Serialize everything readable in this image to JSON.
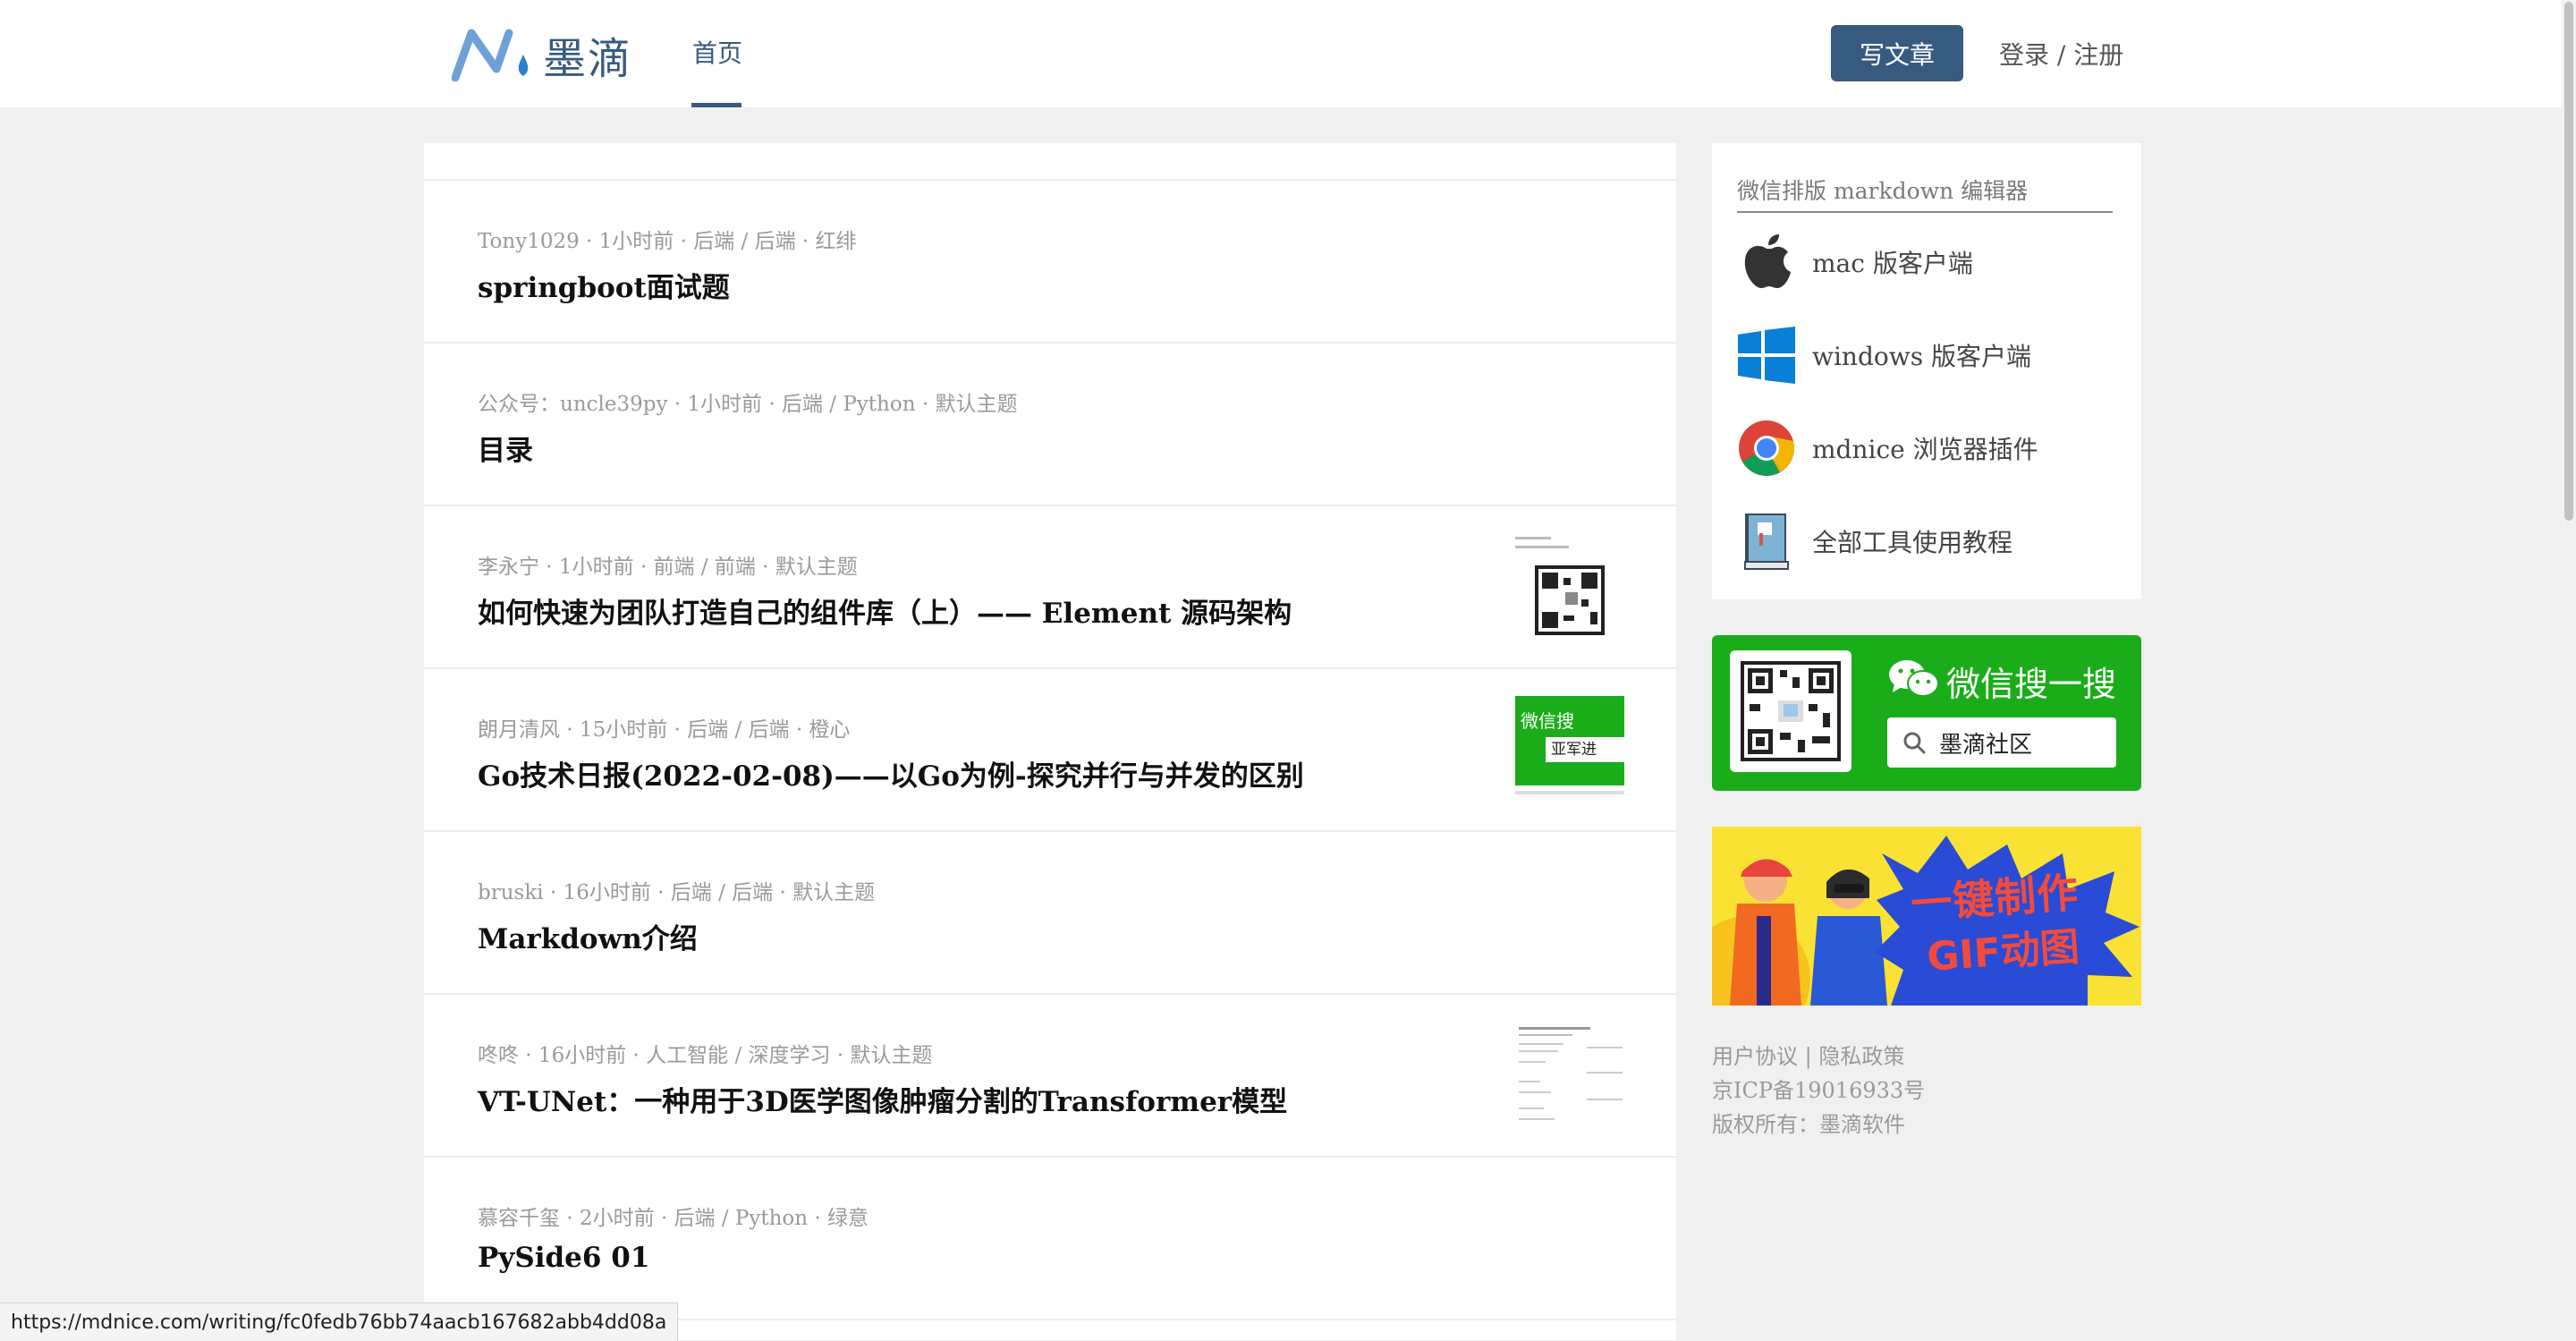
{
  "header": {
    "logo_text": "墨滴",
    "nav_home": "首页",
    "write_button": "写文章",
    "login": "登录",
    "separator": " / ",
    "register": "注册"
  },
  "articles": [
    {
      "meta": "Tony1029 · 1小时前 · 后端 / 后端 · 红绯",
      "title": "springboot面试题",
      "thumb": ""
    },
    {
      "meta": "公众号：uncle39py · 1小时前 · 后端 / Python · 默认主题",
      "title": "目录",
      "thumb": ""
    },
    {
      "meta": "李永宁 · 1小时前 · 前端 / 前端 · 默认主题",
      "title": "如何快速为团队打造自己的组件库（上）—— Element 源码架构",
      "thumb": "qr"
    },
    {
      "meta": "朗月清风 · 15小时前 · 后端 / 后端 · 橙心",
      "title": "Go技术日报(2022-02-08)——以Go为例-探究并行与并发的区别",
      "thumb": "wechat"
    },
    {
      "meta": "bruski · 16小时前 · 后端 / 后端 · 默认主题",
      "title": "Markdown介绍",
      "thumb": ""
    },
    {
      "meta": "咚咚 · 16小时前 · 人工智能 / 深度学习 · 默认主题",
      "title": "VT-UNet：一种用于3D医学图像肿瘤分割的Transformer模型",
      "thumb": "paper"
    },
    {
      "meta": "慕容千玺 · 2小时前 · 后端 / Python · 绿意",
      "title": "PySide6 01",
      "thumb": ""
    }
  ],
  "thumb_text": {
    "wechat_label": "微信搜",
    "wechat_search": "亚军进"
  },
  "sidebar": {
    "tools_heading": "微信排版 markdown 编辑器",
    "tools": [
      {
        "icon": "apple-icon",
        "label": "mac 版客户端"
      },
      {
        "icon": "windows-icon",
        "label": "windows 版客户端"
      },
      {
        "icon": "chrome-icon",
        "label": "mdnice 浏览器插件"
      },
      {
        "icon": "book-icon",
        "label": "全部工具使用教程"
      }
    ],
    "wechat_title": "微信搜一搜",
    "wechat_search_label": "墨滴社区",
    "banner_line1": "一键制作",
    "banner_line2": "GIF动图"
  },
  "footer": {
    "user_agreement": "用户协议",
    "divider": " | ",
    "privacy": "隐私政策",
    "icp": "京ICP备19016933号",
    "copyright": "版权所有：墨滴软件"
  },
  "status_url": "https://mdnice.com/writing/fc0fedb76bb74aacb167682abb4dd08a",
  "colors": {
    "brand": "#375a7f",
    "wechat_green": "#1aad19",
    "banner_yellow": "#f9e233"
  }
}
